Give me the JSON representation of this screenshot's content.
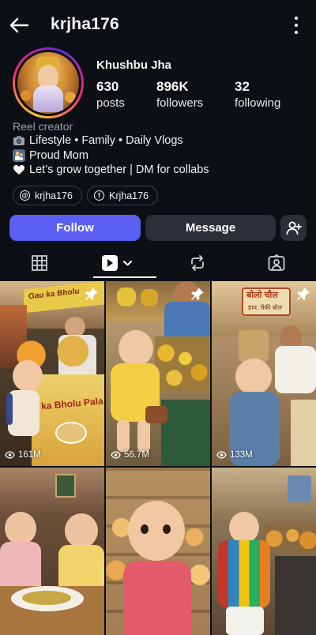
{
  "header": {
    "username": "krjha176"
  },
  "profile": {
    "display_name": "Khushbu Jha",
    "stats": [
      {
        "value": "630",
        "label": "posts"
      },
      {
        "value": "896K",
        "label": "followers"
      },
      {
        "value": "32",
        "label": "following"
      }
    ],
    "category": "Reel creator",
    "bio_lines": [
      {
        "icon": "camera-emoji",
        "text": "Lifestyle • Family • Daily Vlogs"
      },
      {
        "icon": "parent-child-emoji",
        "text": "Proud Mom"
      },
      {
        "icon": "white-heart-emoji",
        "text": "Let’s grow together | DM for collabs"
      }
    ],
    "links": [
      {
        "icon": "threads-icon",
        "label": "krjha176"
      },
      {
        "icon": "facebook-icon",
        "label": "Krjha176"
      }
    ]
  },
  "actions": {
    "follow": "Follow",
    "message": "Message",
    "follow_color": "#5b5ff2"
  },
  "tabs": [
    {
      "icon": "grid-icon",
      "active": false
    },
    {
      "icon": "reels-icon",
      "active": true
    },
    {
      "icon": "reposts-icon",
      "active": false
    },
    {
      "icon": "tagged-icon",
      "active": false
    }
  ],
  "grid": [
    {
      "views": "161M",
      "pinned": true,
      "sign": "Gau ka Bholu",
      "sign2": "ka Bholu Pala"
    },
    {
      "views": "56.7M",
      "pinned": true
    },
    {
      "views": "133M",
      "pinned": true,
      "sign": "बोलो चौल",
      "sign_sub": "हाय, चेकी बोल"
    },
    {
      "views": null,
      "pinned": false
    },
    {
      "views": null,
      "pinned": false
    },
    {
      "views": null,
      "pinned": false
    }
  ]
}
